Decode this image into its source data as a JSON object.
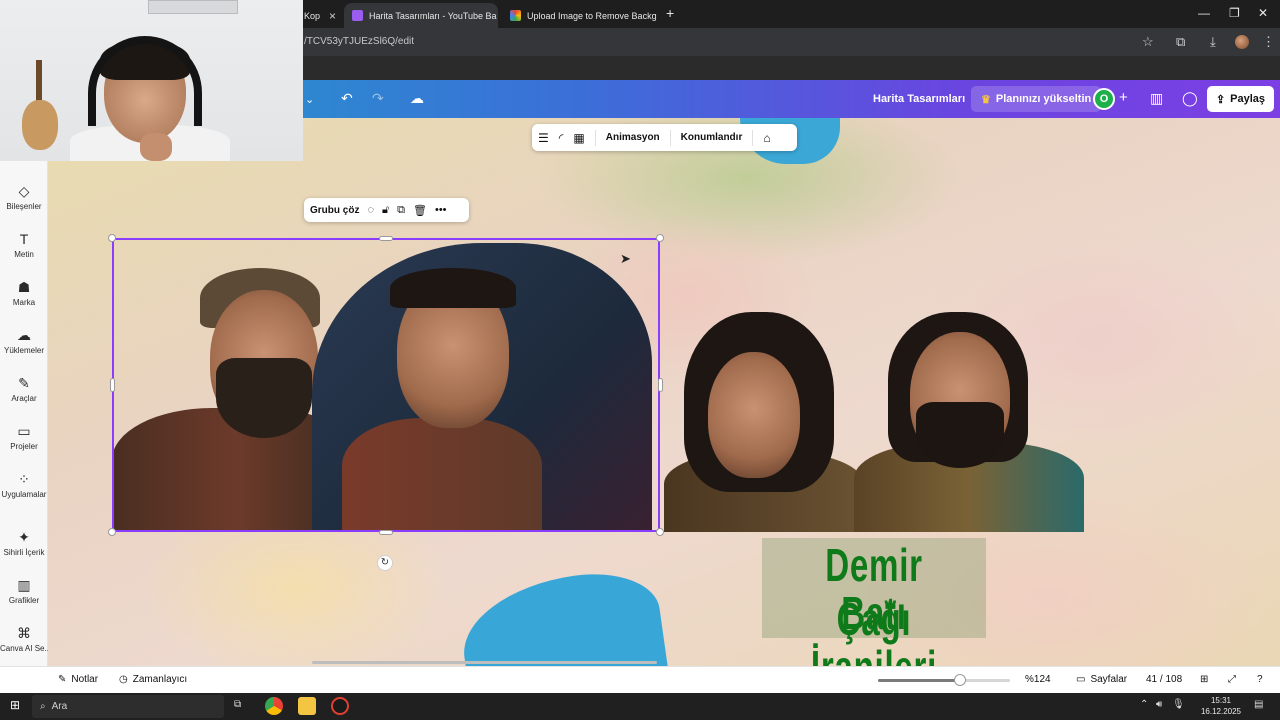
{
  "browser": {
    "tabs": [
      {
        "label": "Kop",
        "active": false
      },
      {
        "label": "Harita Tasarımları - YouTube Ba",
        "active": true
      },
      {
        "label": "Upload Image to Remove Backg",
        "active": false
      }
    ],
    "new_tab_symbol": "+",
    "url": "/TCV53yTJUEzSl6Q/edit",
    "window_controls": {
      "minimize": "—",
      "restore": "❐",
      "close": "✕"
    }
  },
  "canva_header": {
    "doc_title": "Harita Tasarımları",
    "upgrade_label": "Planınızı yükseltin",
    "upgrade_icon": "crown-icon",
    "avatar_letter": "O",
    "add_symbol": "+",
    "share_label": "Paylaş",
    "colors": {
      "gradient_start": "#1fa2c8",
      "gradient_end": "#7c3fe4",
      "avatar": "#1bb04a"
    }
  },
  "sidebar": {
    "items": [
      {
        "label": "Bileşenler",
        "icon": "elements-icon",
        "glyph": "◇"
      },
      {
        "label": "Metin",
        "icon": "text-icon",
        "glyph": "T"
      },
      {
        "label": "Marka",
        "icon": "brand-icon",
        "glyph": "☗"
      },
      {
        "label": "Yüklemeler",
        "icon": "upload-cloud-icon",
        "glyph": "☁"
      },
      {
        "label": "Araçlar",
        "icon": "draw-icon",
        "glyph": "✎"
      },
      {
        "label": "Projeler",
        "icon": "folder-icon",
        "glyph": "▭"
      },
      {
        "label": "Uygulamalar",
        "icon": "apps-icon",
        "glyph": "⁘"
      },
      {
        "label": "Sihirli İçerik",
        "icon": "magic-media-icon",
        "glyph": "✦"
      },
      {
        "label": "Grafikler",
        "icon": "charts-icon",
        "glyph": "▥"
      },
      {
        "label": "Canva AI Se...",
        "icon": "canva-ai-icon",
        "glyph": "⌘"
      }
    ]
  },
  "context_toolbar": {
    "animate_label": "Animasyon",
    "position_label": "Konumlandır"
  },
  "group_toolbar": {
    "ungroup_label": "Grubu çöz"
  },
  "canvas": {
    "title_line1": "Demir Çağı",
    "title_line2": "Batı İranileri",
    "title_color": "#0f7a19"
  },
  "bottom_bar": {
    "notes_label": "Notlar",
    "timer_label": "Zamanlayıcı",
    "zoom_label": "%124",
    "zoom_fraction": 0.62,
    "pages_label": "Sayfalar",
    "page_counter": "41 / 108"
  },
  "taskbar": {
    "search_placeholder": "Ara",
    "time": "15:31",
    "date": "16.12.2025"
  }
}
